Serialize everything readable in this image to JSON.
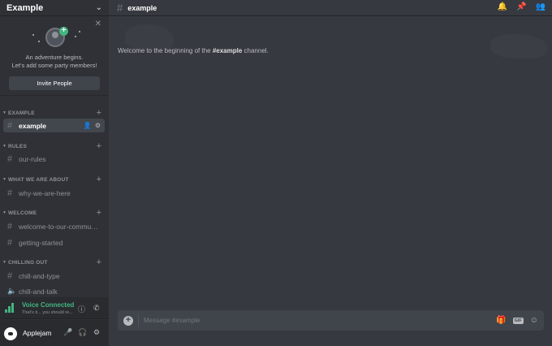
{
  "server": {
    "name": "Example"
  },
  "invite": {
    "line1": "An adventure begins.",
    "line2": "Let's add some party members!",
    "button": "Invite People"
  },
  "categories": [
    {
      "label": "EXAMPLE"
    },
    {
      "label": "RULES"
    },
    {
      "label": "WHAT WE ARE ABOUT"
    },
    {
      "label": "WELCOME"
    },
    {
      "label": "CHILLING OUT"
    }
  ],
  "channels": {
    "example": "example",
    "rules": "our-rules",
    "about": "why-we-are-here",
    "welcome1": "welcome-to-our-community",
    "welcome2": "getting-started",
    "chill1": "chill-and-type",
    "chill2": "chill-and-talk"
  },
  "voice": {
    "status": "Voice Connected",
    "sub": "That's it... you should re..."
  },
  "user": {
    "name": "Applejam"
  },
  "main": {
    "channel_name": "example",
    "welcome_prefix": "Welcome to the beginning of the ",
    "welcome_channel": "#example",
    "welcome_suffix": " channel."
  },
  "composer": {
    "placeholder": "Message #example",
    "gif_label": "GIF"
  },
  "colors": {
    "accent": "#43b581",
    "bg": "#36393f",
    "sidebar": "#2f3136"
  },
  "icons": [
    "chevron-down-icon",
    "close-icon",
    "plus-icon",
    "invite-member-icon",
    "gear-icon",
    "signal-icon",
    "info-icon",
    "phone-disconnect-icon",
    "microphone-icon",
    "headphones-icon",
    "bell-icon",
    "pin-icon",
    "members-icon",
    "gift-icon",
    "gif-icon",
    "emoji-icon"
  ]
}
